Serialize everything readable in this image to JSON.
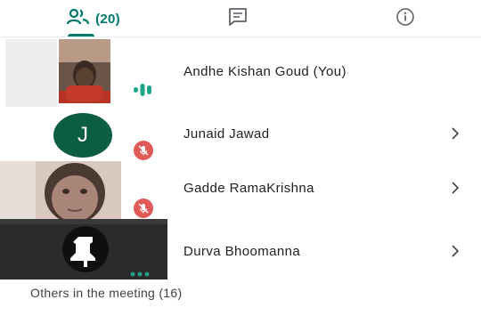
{
  "tabs": {
    "people_count": "(20)",
    "people_icon": "people-icon",
    "chat_icon": "chat-icon",
    "info_icon": "info-icon",
    "accent_color": "#00796b"
  },
  "participants": [
    {
      "name": "Andhe Kishan Goud (You)",
      "status_icon": "speaking-icon"
    },
    {
      "name": "Junaid Jawad",
      "avatar_letter": "J",
      "status_icon": "mic-off-icon"
    },
    {
      "name": "Gadde RamaKrishna",
      "status_icon": "mic-off-icon"
    },
    {
      "name": "Durva Bhoomanna",
      "status_icon": "more-dots-icon"
    }
  ],
  "footer": {
    "others_label": "Others in the meeting (16)"
  }
}
